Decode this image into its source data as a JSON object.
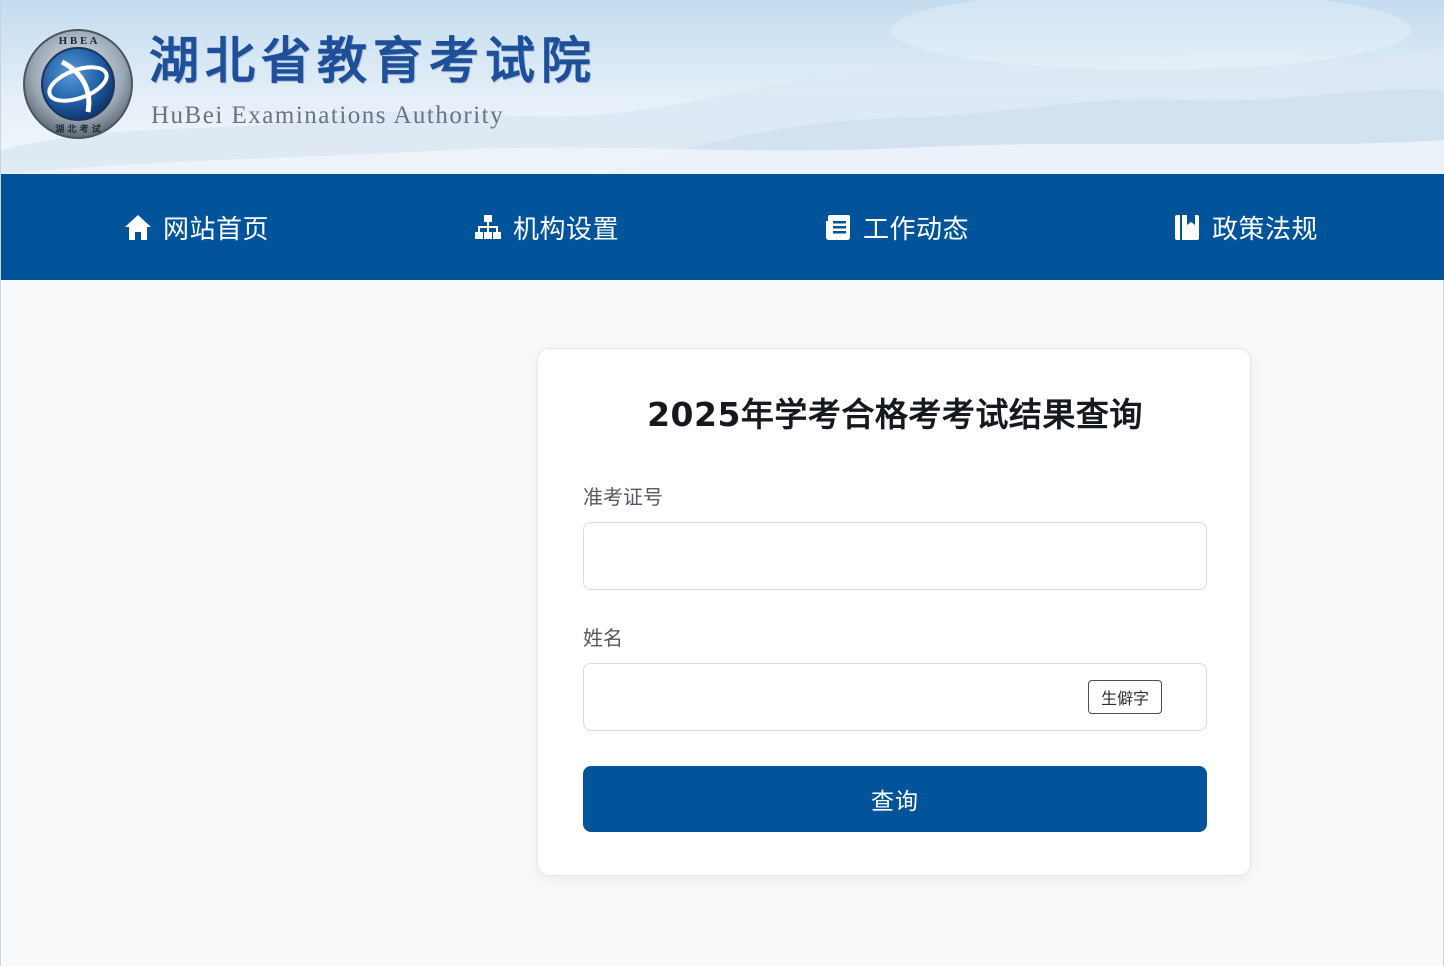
{
  "header": {
    "site_name_cn": "湖北省教育考试院",
    "site_name_en": "HuBei Examinations Authority",
    "emblem": {
      "top_text": "H B E A",
      "bottom_text": "湖 北 考 试"
    }
  },
  "nav": {
    "items": [
      {
        "label": "网站首页",
        "icon": "home-icon"
      },
      {
        "label": "机构设置",
        "icon": "org-chart-icon"
      },
      {
        "label": "工作动态",
        "icon": "document-icon"
      },
      {
        "label": "政策法规",
        "icon": "book-icon"
      }
    ]
  },
  "query": {
    "title": "2025年学考合格考考试结果查询",
    "ticket_label": "准考证号",
    "ticket_value": "",
    "name_label": "姓名",
    "name_value": "",
    "rare_char_label": "生僻字",
    "submit_label": "查询"
  },
  "colors": {
    "primary": "#02549a",
    "page_background": "#f7f9fb",
    "brand_text": "#1f4f98"
  }
}
